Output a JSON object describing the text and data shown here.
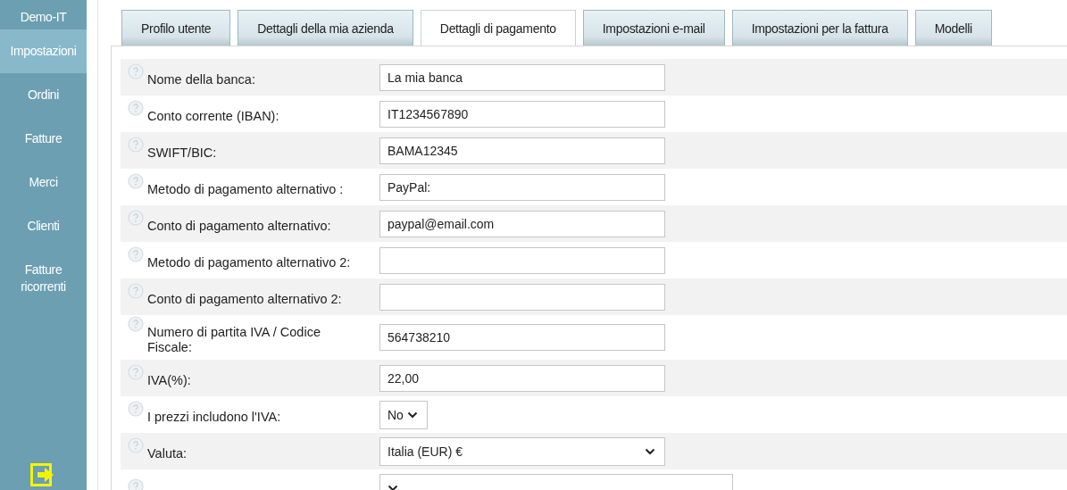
{
  "sidebar": {
    "title": "Demo-IT",
    "items": [
      {
        "label": "Impostazioni",
        "selected": true
      },
      {
        "label": "Ordini",
        "selected": false
      },
      {
        "label": "Fatture",
        "selected": false
      },
      {
        "label": "Merci",
        "selected": false
      },
      {
        "label": "Clienti",
        "selected": false
      },
      {
        "label": "Fatture ricorrenti",
        "selected": false
      }
    ]
  },
  "tabs": [
    {
      "label": "Profilo utente",
      "selected": false
    },
    {
      "label": "Dettagli della mia azienda",
      "selected": false
    },
    {
      "label": "Dettagli di pagamento",
      "selected": true
    },
    {
      "label": "Impostazioni e-mail",
      "selected": false
    },
    {
      "label": "Impostazioni per la fattura",
      "selected": false
    },
    {
      "label": "Modelli",
      "selected": false
    }
  ],
  "form": [
    {
      "label": "Nome della banca:",
      "kind": "text",
      "value": "La mia banca"
    },
    {
      "label": "Conto corrente (IBAN):",
      "kind": "text",
      "value": "IT1234567890"
    },
    {
      "label": "SWIFT/BIC:",
      "kind": "text",
      "value": "BAMA12345"
    },
    {
      "label": "Metodo di pagamento alternativo :",
      "kind": "text",
      "value": "PayPal:"
    },
    {
      "label": "Conto di pagamento alternativo:",
      "kind": "text",
      "value": "paypal@email.com"
    },
    {
      "label": "Metodo di pagamento alternativo 2:",
      "kind": "text"
    },
    {
      "label": "Conto di pagamento alternativo 2:",
      "kind": "text"
    },
    {
      "label": "Numero di partita IVA / Codice Fiscale:",
      "kind": "text",
      "value": "564738210"
    },
    {
      "label": "IVA(%):",
      "kind": "text",
      "value": "22,00"
    },
    {
      "label": "I prezzi includono l'IVA:",
      "kind": "short-select",
      "value": "No"
    },
    {
      "label": "Valuta:",
      "kind": "select",
      "value": "Italia (EUR) €"
    },
    {
      "kind": "wide-select"
    }
  ]
}
